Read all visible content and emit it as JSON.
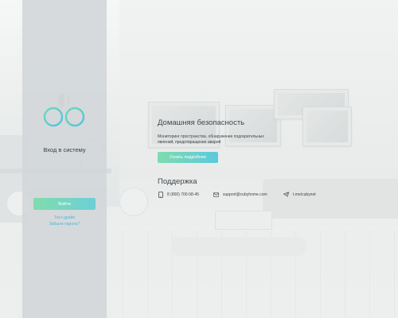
{
  "login_panel": {
    "title": "Вход в систему",
    "enter_button": "Войти",
    "test_link": "Тест-драйв",
    "forgot_link": "Забыли пароль?"
  },
  "security": {
    "title": "Домашняя безопасность",
    "description": "Мониторинг пространства, обнаружение подозрительных явлений, предотвращение аварий",
    "more_button": "Узнать подробнее"
  },
  "support": {
    "title": "Поддержка",
    "phone": "8 (800) 700-58-45",
    "email": "support@cubyhome.com",
    "telegram": "t.me/cubynet"
  },
  "colors": {
    "accent_green": "#7fdcae",
    "accent_cyan": "#5cc9dd",
    "link": "#4fb6d7",
    "panel": "#d2d6d8"
  },
  "icons": {
    "logo": "cuby-logo-icon",
    "phone": "phone-icon",
    "email": "envelope-icon",
    "telegram": "telegram-icon"
  }
}
